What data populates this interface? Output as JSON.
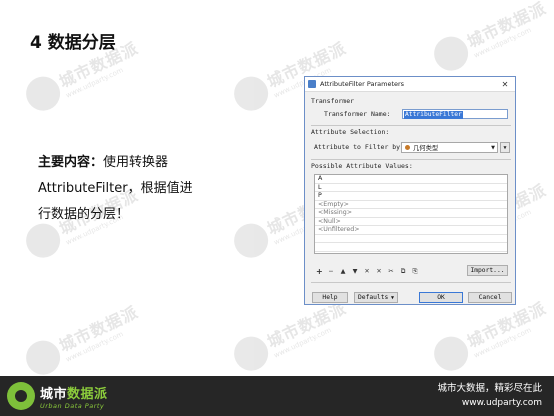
{
  "slide": {
    "title": "4 数据分层",
    "description_head": "主要内容：",
    "description_body_1": "使用转换器",
    "description_body_2": "AttributeFilter，根据值进",
    "description_body_3": "行数据的分层！"
  },
  "watermark": {
    "text": "城市数据派",
    "url": "www.udparty.com"
  },
  "dialog": {
    "title": "AttributeFilter Parameters",
    "close_glyph": "✕",
    "transformer_group": "Transformer",
    "transformer_name_label": "Transformer Name:",
    "transformer_name_value": "AttributeFilter",
    "attr_selection_group": "Attribute Selection:",
    "filter_by_label": "Attribute to Filter by:",
    "filter_by_value": "几何类型",
    "possible_values_label": "Possible Attribute Values:",
    "values": [
      "A",
      "L",
      "P",
      "<Empty>",
      "<Missing>",
      "<Null>",
      "<Unfiltered>",
      "",
      ""
    ],
    "toolbar": [
      "+",
      "−",
      "▲",
      "▼",
      "✕",
      "✕",
      "✂",
      "⧉",
      "⎘"
    ],
    "import_label": "Import...",
    "help_label": "Help",
    "defaults_label": "Defaults",
    "ok_label": "OK",
    "cancel_label": "Cancel"
  },
  "footer": {
    "logo_main_1": "城市",
    "logo_main_2": "数据派",
    "logo_sub": "Urban Data Party",
    "tagline": "城市大数据，精彩尽在此",
    "url": "www.udparty.com"
  },
  "colors": {
    "footer_bg": "#262626",
    "brand_green": "#8ccc3c",
    "selection_blue": "#3a78d6"
  }
}
